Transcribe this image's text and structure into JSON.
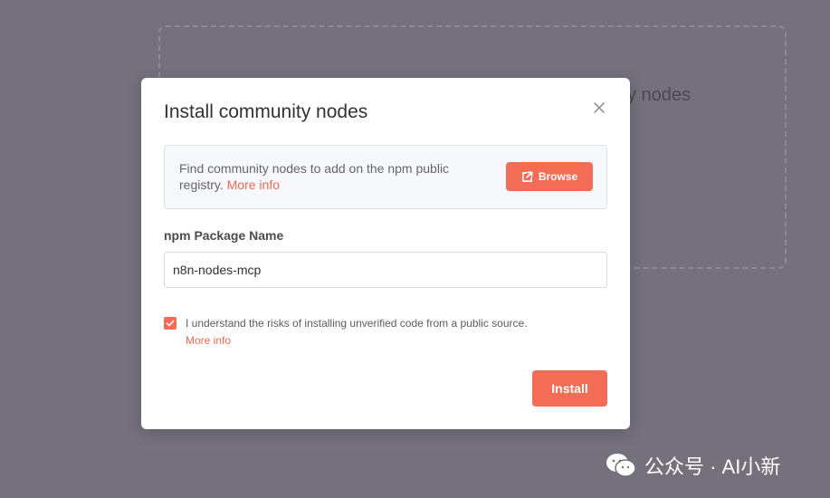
{
  "background": {
    "partial_text": "y nodes"
  },
  "modal": {
    "title": "Install community nodes",
    "info": {
      "text": "Find community nodes to add on the npm public registry.",
      "more_info": "More info",
      "browse_label": "Browse"
    },
    "package_field": {
      "label": "npm Package Name",
      "value": "n8n-nodes-mcp"
    },
    "risk_checkbox": {
      "checked": true,
      "text": "I understand the risks of installing unverified code from a public source.",
      "more_info": "More info"
    },
    "install_label": "Install"
  },
  "watermark": {
    "text": "公众号 · AI小新"
  },
  "colors": {
    "accent": "#f36c55",
    "overlay": "#74717d"
  },
  "icons": [
    "close-icon",
    "external-link-icon",
    "checkmark-icon",
    "wechat-icon"
  ]
}
